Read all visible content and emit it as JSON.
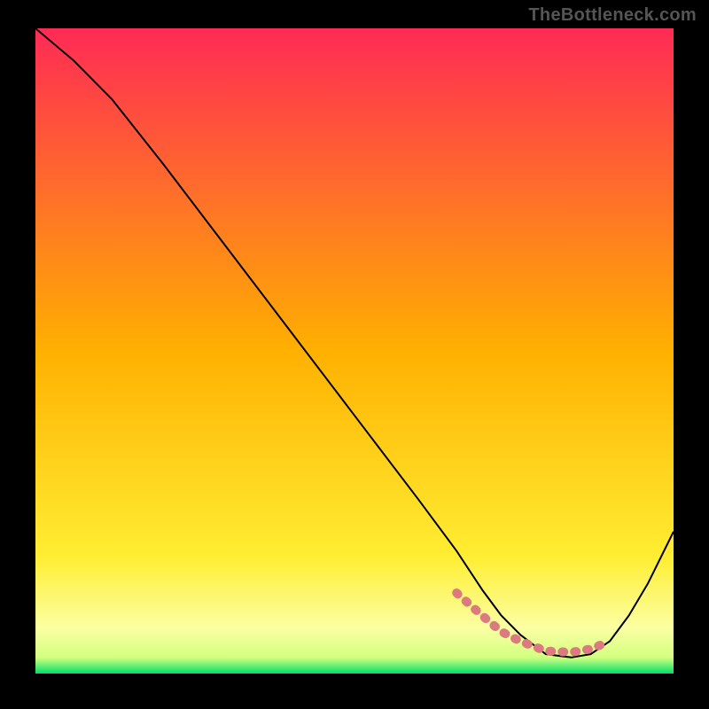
{
  "watermark": "TheBottleneck.com",
  "chart_data": {
    "type": "line",
    "title": "",
    "xlabel": "",
    "ylabel": "",
    "xlim": [
      0,
      100
    ],
    "ylim": [
      0,
      100
    ],
    "gradient": {
      "stops": [
        {
          "offset": 0.0,
          "color": "#ff2a55"
        },
        {
          "offset": 0.5,
          "color": "#ffb000"
        },
        {
          "offset": 0.82,
          "color": "#ffee33"
        },
        {
          "offset": 0.93,
          "color": "#fbffa3"
        },
        {
          "offset": 0.975,
          "color": "#d3ff80"
        },
        {
          "offset": 1.0,
          "color": "#00e06a"
        }
      ]
    },
    "series": [
      {
        "name": "bottleneck-curve",
        "color": "#000000",
        "width": 2,
        "x": [
          0,
          6,
          12,
          20,
          30,
          40,
          50,
          60,
          66,
          70,
          73,
          76,
          80,
          84,
          87,
          90,
          93,
          96,
          100
        ],
        "y": [
          100,
          95,
          89,
          79,
          66,
          53,
          40,
          27,
          19,
          13,
          9,
          6,
          3,
          2.5,
          3,
          5,
          9,
          14,
          22
        ]
      },
      {
        "name": "optimal-band",
        "color": "#db7b80",
        "width": 10,
        "dash": "2 12",
        "linecap": "round",
        "x": [
          66,
          70,
          73,
          76,
          80,
          84,
          87,
          90
        ],
        "y": [
          12.5,
          9.0,
          6.5,
          5.0,
          3.5,
          3.3,
          3.8,
          5.0
        ]
      }
    ]
  }
}
